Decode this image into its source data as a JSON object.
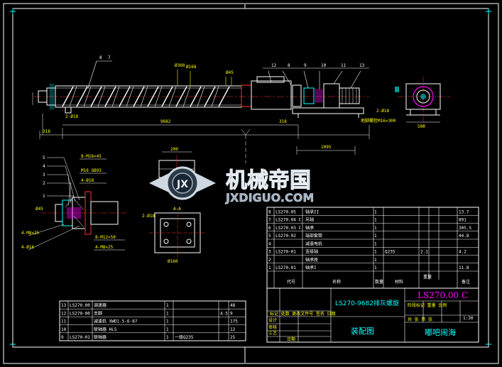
{
  "drawing": {
    "part_number": "LS270.00 C",
    "title": "LS270-9682排灰螺旋",
    "assembly_label": "装配图",
    "company": "嘟吧闹海",
    "scale": "1:30"
  },
  "balloons": [
    "8",
    "7",
    "12",
    "8",
    "9",
    "10",
    "11",
    "13"
  ],
  "section_labels": [
    "5",
    "4",
    "3",
    "2",
    "1"
  ],
  "watermark": {
    "cn": "机械帝国",
    "en": "JXDIGUO.COM",
    "badge": "JX"
  },
  "bom_headers": {
    "code": "代号",
    "name": "名称",
    "qty": "数量",
    "material": "材料",
    "weight": "重量",
    "remark": "备注"
  },
  "bom_rows": [
    {
      "no": "8",
      "code": "LS270.05",
      "name": "轴承II",
      "qty": "1",
      "mat": "",
      "w": "",
      "rem": "13.7"
    },
    {
      "no": "7",
      "code": "LS270.04 C",
      "name": "吊轴",
      "qty": "1",
      "mat": "",
      "w": "",
      "rem": "891"
    },
    {
      "no": "6",
      "code": "LS270.03 C",
      "name": "轴承",
      "qty": "1",
      "mat": "",
      "w": "",
      "rem": "305.5"
    },
    {
      "no": "5",
      "code": "LS270.02",
      "name": "端部套筒",
      "qty": "1",
      "mat": "",
      "w": "",
      "rem": "44.8"
    },
    {
      "no": "4",
      "code": "",
      "name": "减速电机",
      "qty": "1",
      "mat": "",
      "w": "",
      "rem": ""
    },
    {
      "no": "3",
      "code": "LS270-01",
      "name": "连接轴",
      "qty": "1",
      "mat": "Q235",
      "w": "2.1",
      "rem": "4.2"
    },
    {
      "no": "2",
      "code": "",
      "name": "轴承座",
      "qty": "1",
      "mat": "",
      "w": "",
      "rem": ""
    },
    {
      "no": "1",
      "code": "LS270.01",
      "name": "轴承I",
      "qty": "1",
      "mat": "",
      "w": "",
      "rem": "11.8"
    }
  ],
  "parts_left": [
    {
      "no": "13",
      "code": "LS270.00",
      "name": "调速器",
      "qty": "1",
      "mat": "",
      "w": "",
      "rem": "48"
    },
    {
      "no": "12",
      "code": "LS270-00",
      "name": "支脚",
      "qty": "1",
      "mat": "",
      "w": "4.5",
      "rem": "9"
    },
    {
      "no": "11",
      "code": "",
      "name": "减速机 XWD1.5-6-87",
      "qty": "1",
      "mat": "",
      "w": "",
      "rem": "175"
    },
    {
      "no": "10",
      "code": "",
      "name": "联轴器 HL5",
      "qty": "1",
      "mat": "",
      "w": "",
      "rem": "12"
    },
    {
      "no": "9",
      "code": "LS270-01",
      "name": "联轴器",
      "qty": "1",
      "mat": "一级Q235",
      "w": "",
      "rem": "25"
    }
  ]
}
